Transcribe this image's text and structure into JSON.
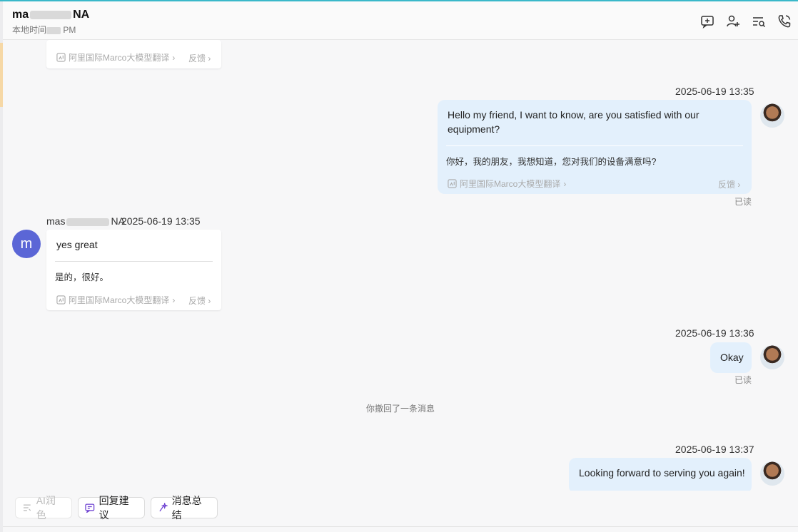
{
  "header": {
    "name_prefix": "ma",
    "name_suffix": "NA",
    "local_time_prefix": "本地时间",
    "local_time_suffix": "PM",
    "icons": [
      "new-topic-icon",
      "add-contact-icon",
      "search-history-icon",
      "call-icon"
    ]
  },
  "translation": {
    "provider": "阿里国际Marco大模型翻译",
    "feedback": "反馈"
  },
  "messages": {
    "m1": {
      "timestamp": "2025-06-19 13:35",
      "text_line1": "Hello my friend, I want to know, are you satisfied with our",
      "text_line2": "equipment?",
      "translation": "你好，我的朋友，我想知道，您对我们的设备满意吗?",
      "status": "已读"
    },
    "m2": {
      "sender_prefix": "mas",
      "sender_suffix": "NA",
      "timestamp": "2025-06-19 13:35",
      "avatar_letter": "m",
      "text": "yes great",
      "translation": "是的，很好。"
    },
    "m3": {
      "timestamp": "2025-06-19 13:36",
      "text": "Okay",
      "status": "已读"
    },
    "recall_notice": "你撤回了一条消息",
    "m4": {
      "timestamp": "2025-06-19 13:37",
      "text": "Looking forward to serving you again!"
    }
  },
  "toolbar": {
    "ai_polish": "AI润色",
    "reply_suggestion": "回复建议",
    "message_summary": "消息总结"
  },
  "colors": {
    "outgoing_bubble": "#e3f0fc",
    "avatar_bg": "#5b66d6",
    "accent": "#3ab8c9"
  }
}
